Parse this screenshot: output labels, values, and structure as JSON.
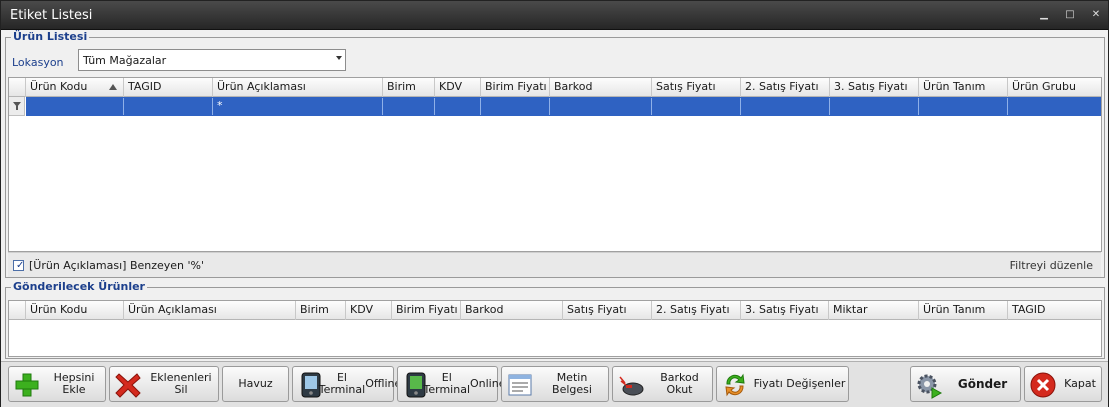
{
  "window": {
    "title": "Etiket Listesi",
    "controls": {
      "minimize": "▁",
      "maximize": "□",
      "close": "✕"
    }
  },
  "urun_listesi": {
    "group_title": "Ürün Listesi",
    "lokasyon_label": "Lokasyon",
    "lokasyon_value": "Tüm Mağazalar",
    "columns": [
      "Ürün Kodu",
      "TAGID",
      "Ürün Açıklaması",
      "Birim",
      "KDV",
      "Birim Fiyatı",
      "Barkod",
      "Satış Fiyatı",
      "2. Satış Fiyatı",
      "3. Satış Fiyatı",
      "Ürün Tanım",
      "Ürün Grubu"
    ],
    "filter_row_value": "*",
    "filter_text": "[Ürün Açıklaması] Benzeyen '%'",
    "filter_edit": "Filtreyi düzenle"
  },
  "gonderilecek": {
    "group_title": "Gönderilecek Ürünler",
    "columns": [
      "Ürün Kodu",
      "Ürün Açıklaması",
      "Birim",
      "KDV",
      "Birim Fiyatı",
      "Barkod",
      "Satış Fiyatı",
      "2. Satış Fiyatı",
      "3. Satış Fiyatı",
      "Miktar",
      "Ürün Tanım",
      "TAGID"
    ]
  },
  "buttons": {
    "hepsini_ekle": "Hepsini Ekle",
    "eklenenleri_sil": "Eklenenleri Sil",
    "havuz": "Havuz",
    "el_terminal_offline_1": "El Terminal",
    "el_terminal_offline_2": "Offline",
    "el_terminal_online_1": "El Terminal",
    "el_terminal_online_2": "Online",
    "metin_belgesi": "Metin Belgesi",
    "barkod_okut": "Barkod Okut",
    "fiyati_degisenler": "Fiyatı Değişenler",
    "gonder": "Gönder",
    "kapat": "Kapat"
  },
  "colors": {
    "selection": "#2f62c2",
    "group_title": "#1c3f8c",
    "add_green": "#3cb01e",
    "delete_red": "#d42a1e"
  }
}
